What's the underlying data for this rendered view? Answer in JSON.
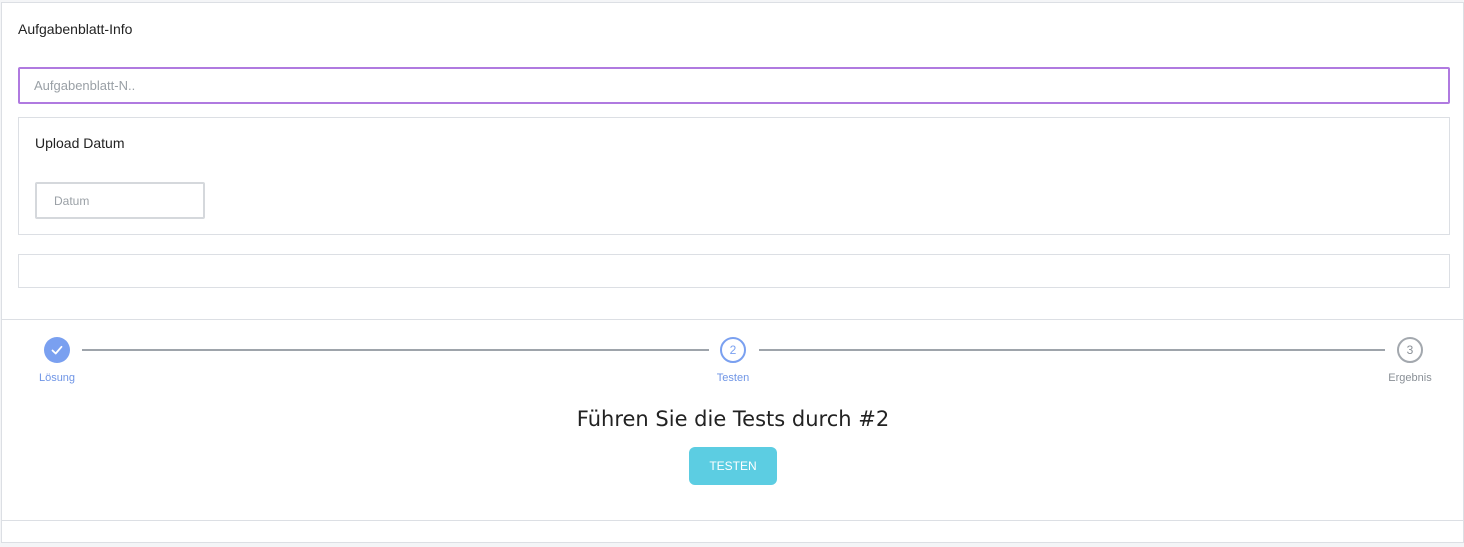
{
  "worksheet_info": {
    "title": "Aufgabenblatt-Info",
    "name_placeholder": "Aufgabenblatt-N..",
    "name_value": ""
  },
  "upload_date": {
    "title": "Upload Datum",
    "date_placeholder": "Datum",
    "date_value": ""
  },
  "stepper": {
    "steps": [
      {
        "label": "Lösung",
        "number": "",
        "state": "done"
      },
      {
        "label": "Testen",
        "number": "2",
        "state": "active"
      },
      {
        "label": "Ergebnis",
        "number": "3",
        "state": "pending"
      }
    ],
    "heading": "Führen Sie die Tests durch #2",
    "button_label": "TESTEN"
  },
  "colors": {
    "accent": "#7aa0f0",
    "input_focus": "#b07ae0",
    "button": "#5ccde2"
  }
}
